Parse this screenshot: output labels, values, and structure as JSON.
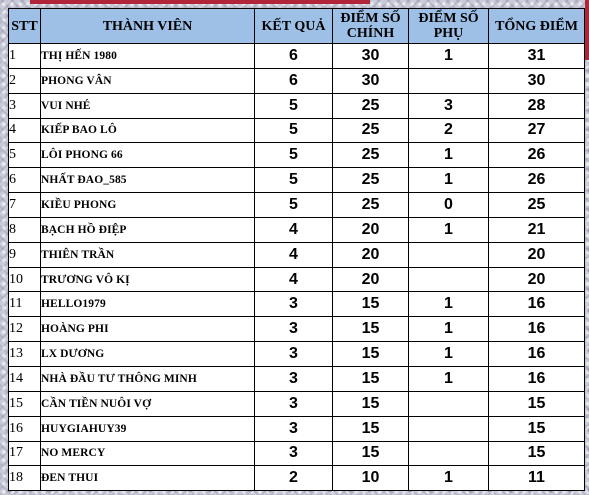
{
  "table": {
    "headers": {
      "stt": "STT",
      "member": "THÀNH VIÊN",
      "result": "KẾT QUẢ",
      "main_score": "ĐIỂM SỐ CHÍNH",
      "sub_score": "ĐIỂM SỐ PHỤ",
      "total": "TỔNG ĐIỂM"
    },
    "rows": [
      {
        "stt": "1",
        "member": "THỊ HẾN 1980",
        "result": "6",
        "main": "30",
        "sub": "1",
        "total": "31"
      },
      {
        "stt": "2",
        "member": "PHONG VÂN",
        "result": "6",
        "main": "30",
        "sub": "",
        "total": "30"
      },
      {
        "stt": "3",
        "member": "VUI NHÉ",
        "result": "5",
        "main": "25",
        "sub": "3",
        "total": "28"
      },
      {
        "stt": "4",
        "member": "KIẾP BAO LÔ",
        "result": "5",
        "main": "25",
        "sub": "2",
        "total": "27"
      },
      {
        "stt": "5",
        "member": "LÔI PHONG 66",
        "result": "5",
        "main": "25",
        "sub": "1",
        "total": "26"
      },
      {
        "stt": "6",
        "member": "NHẤT ĐAO_585",
        "result": "5",
        "main": "25",
        "sub": "1",
        "total": "26"
      },
      {
        "stt": "7",
        "member": "KIỀU PHONG",
        "result": "5",
        "main": "25",
        "sub": "0",
        "total": "25"
      },
      {
        "stt": "8",
        "member": "BẠCH HỒ ĐIỆP",
        "result": "4",
        "main": "20",
        "sub": "1",
        "total": "21"
      },
      {
        "stt": "9",
        "member": "THIÊN TRẦN",
        "result": "4",
        "main": "20",
        "sub": "",
        "total": "20"
      },
      {
        "stt": "10",
        "member": "TRƯƠNG VÔ KỊ",
        "result": "4",
        "main": "20",
        "sub": "",
        "total": "20"
      },
      {
        "stt": "11",
        "member": "HELLO1979",
        "result": "3",
        "main": "15",
        "sub": "1",
        "total": "16"
      },
      {
        "stt": "12",
        "member": "HOÀNG PHI",
        "result": "3",
        "main": "15",
        "sub": "1",
        "total": "16"
      },
      {
        "stt": "13",
        "member": "LX DƯƠNG",
        "result": "3",
        "main": "15",
        "sub": "1",
        "total": "16"
      },
      {
        "stt": "14",
        "member": "NHÀ ĐẦU TƯ THÔNG MINH",
        "result": "3",
        "main": "15",
        "sub": "1",
        "total": "16"
      },
      {
        "stt": "15",
        "member": "CẦN TIỀN NUÔI VỢ",
        "result": "3",
        "main": "15",
        "sub": "",
        "total": "15"
      },
      {
        "stt": "16",
        "member": "HUYGIAHUY39",
        "result": "3",
        "main": "15",
        "sub": "",
        "total": "15"
      },
      {
        "stt": "17",
        "member": "NO MERCY",
        "result": "3",
        "main": "15",
        "sub": "",
        "total": "15"
      },
      {
        "stt": "18",
        "member": "ĐEN THUI",
        "result": "2",
        "main": "10",
        "sub": "1",
        "total": "11"
      }
    ]
  },
  "colors": {
    "header_bg": "#9ec0e6",
    "cell_bg": "#ffffff",
    "frame_accent": "#b0253a"
  }
}
